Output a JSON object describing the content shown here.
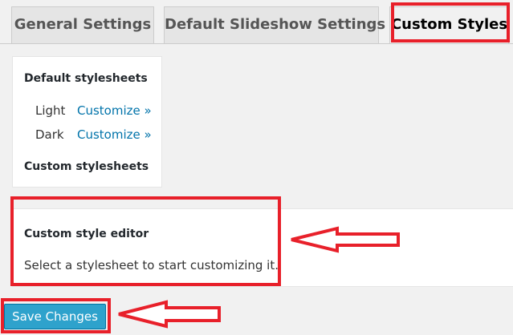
{
  "tabs": [
    {
      "label": "General Settings"
    },
    {
      "label": "Default Slideshow Settings"
    },
    {
      "label": "Custom Styles"
    }
  ],
  "stylesheets": {
    "default_heading": "Default stylesheets",
    "items": [
      {
        "name": "Light",
        "link": "Customize »"
      },
      {
        "name": "Dark",
        "link": "Customize »"
      }
    ],
    "custom_heading": "Custom stylesheets"
  },
  "editor": {
    "heading": "Custom style editor",
    "message": "Select a stylesheet to start customizing it."
  },
  "save_button": {
    "label": "Save Changes"
  },
  "colors": {
    "accent": "#0073aa",
    "button": "#2ea2cc",
    "annotation": "#e8202a",
    "background": "#f1f1f1"
  },
  "annotations": {
    "icon": "red-arrow-icon"
  }
}
